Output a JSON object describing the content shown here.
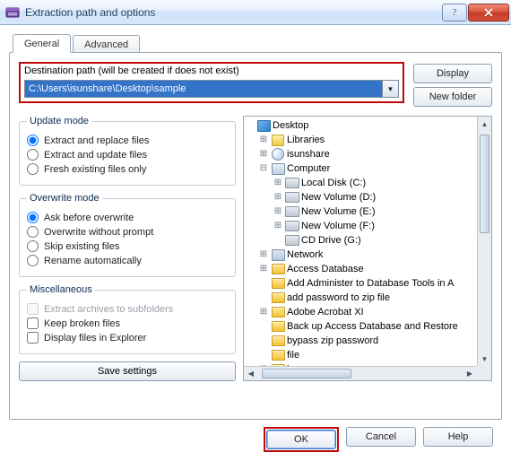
{
  "window": {
    "title": "Extraction path and options"
  },
  "tabs": {
    "general": "General",
    "advanced": "Advanced"
  },
  "dest": {
    "label": "Destination path (will be created if does not exist)",
    "value": "C:\\Users\\isunshare\\Desktop\\sample"
  },
  "side_buttons": {
    "display": "Display",
    "new_folder": "New folder"
  },
  "groups": {
    "update": {
      "legend": "Update mode",
      "opt1": "Extract and replace files",
      "opt2": "Extract and update files",
      "opt3": "Fresh existing files only"
    },
    "overwrite": {
      "legend": "Overwrite mode",
      "opt1": "Ask before overwrite",
      "opt2": "Overwrite without prompt",
      "opt3": "Skip existing files",
      "opt4": "Rename automatically"
    },
    "misc": {
      "legend": "Miscellaneous",
      "chk1": "Extract archives to subfolders",
      "chk2": "Keep broken files",
      "chk3": "Display files in Explorer"
    }
  },
  "save_button": "Save settings",
  "tree": {
    "desktop": "Desktop",
    "libraries": "Libraries",
    "isunshare": "isunshare",
    "computer": "Computer",
    "local_disk": "Local Disk (C:)",
    "new_vol_d": "New Volume (D:)",
    "new_vol_e": "New Volume (E:)",
    "new_vol_f": "New Volume (F:)",
    "cd_drive": "CD Drive (G:)",
    "network": "Network",
    "access_db": "Access Database",
    "add_admin": "Add Administer to Database Tools in A",
    "add_pwd": "add password  to zip file",
    "adobe": "Adobe Acrobat XI",
    "backup": "Back up Access Database and Restore",
    "bypass": "bypass zip password",
    "file": "file",
    "image": "image"
  },
  "bottom": {
    "ok": "OK",
    "cancel": "Cancel",
    "help": "Help"
  }
}
